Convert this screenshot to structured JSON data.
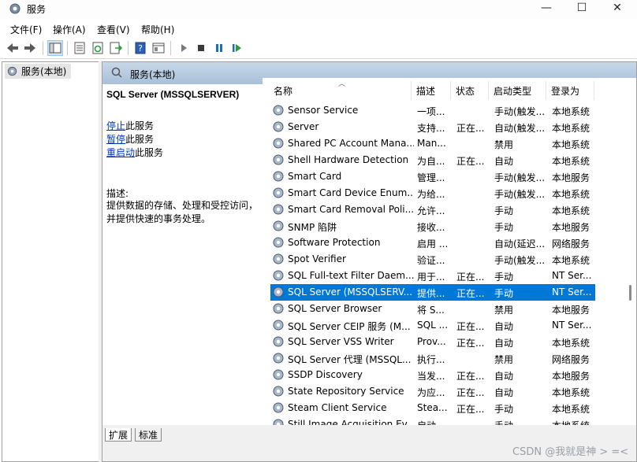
{
  "window": {
    "title": "服务",
    "minimize": "—",
    "maximize": "☐",
    "close": "✕"
  },
  "menu": [
    "文件(F)",
    "操作(A)",
    "查看(V)",
    "帮助(H)"
  ],
  "tree": {
    "item": "服务(本地)"
  },
  "panel": {
    "header": "服务(本地)"
  },
  "description": {
    "service_title": "SQL Server (MSSQLSERVER)",
    "actions": [
      {
        "link": "停止",
        "rest": "此服务"
      },
      {
        "link": "暂停",
        "rest": "此服务"
      },
      {
        "link": "重启动",
        "rest": "此服务"
      }
    ],
    "label": "描述:",
    "text": "提供数据的存储、处理和受控访问，并提供快速的事务处理。"
  },
  "list": {
    "columns": [
      "名称",
      "描述",
      "状态",
      "启动类型",
      "登录为"
    ],
    "rows": [
      {
        "name": "Sensor Service",
        "desc": "一项...",
        "status": "",
        "startup": "手动(触发...",
        "logon": "本地系统",
        "selected": false
      },
      {
        "name": "Server",
        "desc": "支持...",
        "status": "正在...",
        "startup": "自动(触发...",
        "logon": "本地系统",
        "selected": false
      },
      {
        "name": "Shared PC Account Mana...",
        "desc": "Man...",
        "status": "",
        "startup": "禁用",
        "logon": "本地系统",
        "selected": false
      },
      {
        "name": "Shell Hardware Detection",
        "desc": "为自...",
        "status": "正在...",
        "startup": "自动",
        "logon": "本地系统",
        "selected": false
      },
      {
        "name": "Smart Card",
        "desc": "管理...",
        "status": "",
        "startup": "手动(触发...",
        "logon": "本地服务",
        "selected": false
      },
      {
        "name": "Smart Card Device Enum...",
        "desc": "为给...",
        "status": "",
        "startup": "手动(触发...",
        "logon": "本地系统",
        "selected": false
      },
      {
        "name": "Smart Card Removal Poli...",
        "desc": "允许...",
        "status": "",
        "startup": "手动",
        "logon": "本地系统",
        "selected": false
      },
      {
        "name": "SNMP 陷阱",
        "desc": "接收...",
        "status": "",
        "startup": "手动",
        "logon": "本地服务",
        "selected": false
      },
      {
        "name": "Software Protection",
        "desc": "启用 ...",
        "status": "",
        "startup": "自动(延迟...",
        "logon": "网络服务",
        "selected": false
      },
      {
        "name": "Spot Verifier",
        "desc": "验证...",
        "status": "",
        "startup": "手动(触发...",
        "logon": "本地系统",
        "selected": false
      },
      {
        "name": "SQL Full-text Filter Daem...",
        "desc": "用于...",
        "status": "正在...",
        "startup": "手动",
        "logon": "NT Ser...",
        "selected": false
      },
      {
        "name": "SQL Server (MSSQLSERV...",
        "desc": "提供...",
        "status": "正在...",
        "startup": "手动",
        "logon": "NT Ser...",
        "selected": true
      },
      {
        "name": "SQL Server Browser",
        "desc": "将 S...",
        "status": "",
        "startup": "禁用",
        "logon": "本地服务",
        "selected": false
      },
      {
        "name": "SQL Server CEIP 服务 (M...",
        "desc": "SQL ...",
        "status": "正在...",
        "startup": "自动",
        "logon": "NT Ser...",
        "selected": false
      },
      {
        "name": "SQL Server VSS Writer",
        "desc": "Prov...",
        "status": "正在...",
        "startup": "自动",
        "logon": "本地系统",
        "selected": false
      },
      {
        "name": "SQL Server 代理 (MSSQL...",
        "desc": "执行...",
        "status": "",
        "startup": "禁用",
        "logon": "网络服务",
        "selected": false
      },
      {
        "name": "SSDP Discovery",
        "desc": "当发...",
        "status": "正在...",
        "startup": "自动",
        "logon": "本地服务",
        "selected": false
      },
      {
        "name": "State Repository Service",
        "desc": "为应...",
        "status": "正在...",
        "startup": "自动",
        "logon": "本地系统",
        "selected": false
      },
      {
        "name": "Steam Client Service",
        "desc": "Stea...",
        "status": "正在...",
        "startup": "手动",
        "logon": "本地系统",
        "selected": false
      },
      {
        "name": "Still Image Acquisition Ev...",
        "desc": "启动...",
        "status": "",
        "startup": "手动",
        "logon": "本地系统",
        "selected": false
      }
    ]
  },
  "tabs": [
    "扩展",
    "标准"
  ],
  "watermark": "CSDN @我就是神 > =<",
  "colors": {
    "selection": "#0078d7",
    "link": "#0033cc",
    "header_gradient_top": "#c7d7e8",
    "header_gradient_bottom": "#a9c0d9"
  },
  "toolbar_icons": [
    "back-arrow-icon",
    "forward-arrow-icon",
    "console-tree-icon",
    "properties-icon",
    "refresh-icon",
    "export-icon",
    "help-icon",
    "details-icon",
    "play-icon",
    "stop-icon",
    "pause-icon",
    "restart-icon"
  ]
}
